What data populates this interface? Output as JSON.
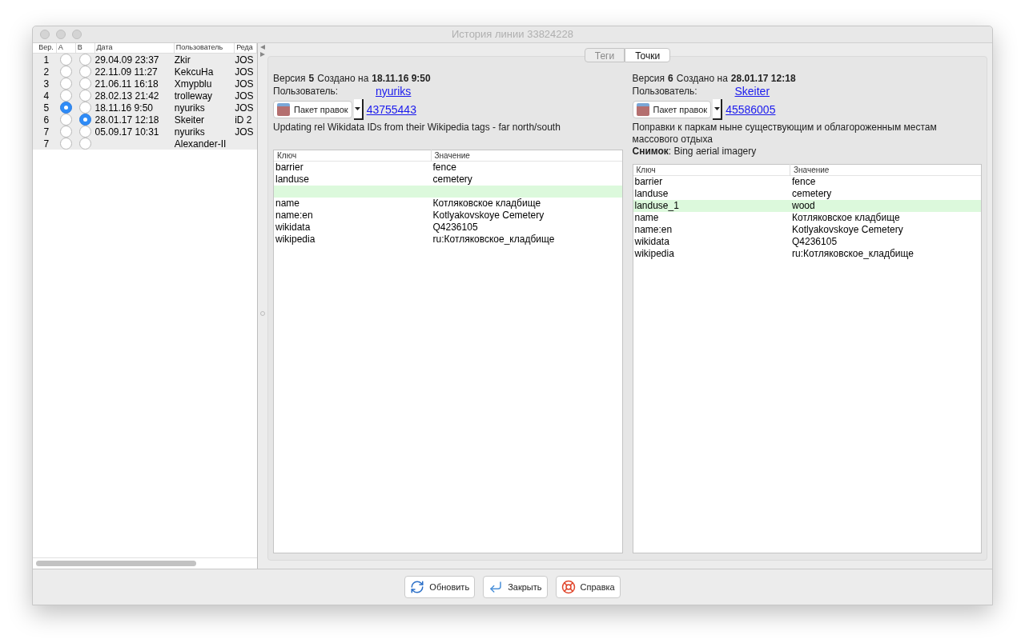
{
  "window": {
    "title": "История линии 33824228"
  },
  "history": {
    "columns": [
      "Вер.",
      "A",
      "B",
      "Дата",
      "Пользователь",
      "Реда"
    ],
    "rows": [
      {
        "version": "1",
        "a_selected": false,
        "b_selected": false,
        "date": "29.04.09 23:37",
        "user": "Zkir",
        "editor": "JOS"
      },
      {
        "version": "2",
        "a_selected": false,
        "b_selected": false,
        "date": "22.11.09 11:27",
        "user": "KekcuHa",
        "editor": "JOS"
      },
      {
        "version": "3",
        "a_selected": false,
        "b_selected": false,
        "date": "21.06.11 16:18",
        "user": "Xmypblu",
        "editor": "JOS"
      },
      {
        "version": "4",
        "a_selected": false,
        "b_selected": false,
        "date": "28.02.13 21:42",
        "user": "trolleway",
        "editor": "JOS"
      },
      {
        "version": "5",
        "a_selected": true,
        "b_selected": false,
        "date": "18.11.16 9:50",
        "user": "nyuriks",
        "editor": "JOS"
      },
      {
        "version": "6",
        "a_selected": false,
        "b_selected": true,
        "date": "28.01.17 12:18",
        "user": "Skeiter",
        "editor": "iD 2"
      },
      {
        "version": "7",
        "a_selected": false,
        "b_selected": false,
        "date": "05.09.17 10:31",
        "user": "nyuriks",
        "editor": "JOS"
      },
      {
        "version": "7",
        "a_selected": false,
        "b_selected": false,
        "user": "Alexander-II"
      }
    ]
  },
  "tabs": [
    {
      "label": "Теги",
      "selected": false,
      "disabled": true
    },
    {
      "label": "Точки",
      "selected": true,
      "disabled": false
    }
  ],
  "versions": [
    {
      "version_label": "Версия",
      "version": "5",
      "created_label": "Создано на",
      "date": "18.11.16 9:50",
      "user_label": "Пользователь:",
      "user": "nyuriks",
      "changeset_button": "Пакет правок",
      "changeset": "43755443",
      "comment": "Updating rel Wikidata IDs from their Wikipedia tags - far north/south",
      "tags": {
        "columns": [
          "Ключ",
          "Значение"
        ],
        "rows": [
          {
            "key": "barrier",
            "value": "fence",
            "added": false
          },
          {
            "key": "landuse",
            "value": "cemetery",
            "added": false
          },
          {
            "added": true
          },
          {
            "key": "name",
            "value": "Котляковское кладбище",
            "added": false
          },
          {
            "key": "name:en",
            "value": "Kotlyakovskoye Cemetery",
            "added": false
          },
          {
            "key": "wikidata",
            "value": "Q4236105",
            "added": false
          },
          {
            "key": "wikipedia",
            "value": "ru:Котляковское_кладбище",
            "added": false
          }
        ]
      }
    },
    {
      "version_label": "Версия",
      "version": "6",
      "created_label": "Создано на",
      "date": "28.01.17 12:18",
      "user_label": "Пользователь:",
      "user": "Skeiter",
      "changeset_button": "Пакет правок",
      "changeset": "45586005",
      "comment": "Поправки к паркам ныне существующим и облагороженным местам массового отдыха",
      "imagery": "**Снимок**: Bing aerial imagery",
      "tags": {
        "columns": [
          "Ключ",
          "Значение"
        ],
        "rows": [
          {
            "key": "barrier",
            "value": "fence",
            "added": false
          },
          {
            "key": "landuse",
            "value": "cemetery",
            "added": false
          },
          {
            "key": "landuse_1",
            "value": "wood",
            "added": true
          },
          {
            "key": "name",
            "value": "Котляковское кладбище",
            "added": false
          },
          {
            "key": "name:en",
            "value": "Kotlyakovskoye Cemetery",
            "added": false
          },
          {
            "key": "wikidata",
            "value": "Q4236105",
            "added": false
          },
          {
            "key": "wikipedia",
            "value": "ru:Котляковское_кладбище",
            "added": false
          }
        ]
      }
    }
  ],
  "buttons": [
    {
      "label": "Обновить",
      "kind": "refresh"
    },
    {
      "label": "Закрыть",
      "kind": "close"
    },
    {
      "label": "Справка",
      "kind": "help"
    }
  ]
}
